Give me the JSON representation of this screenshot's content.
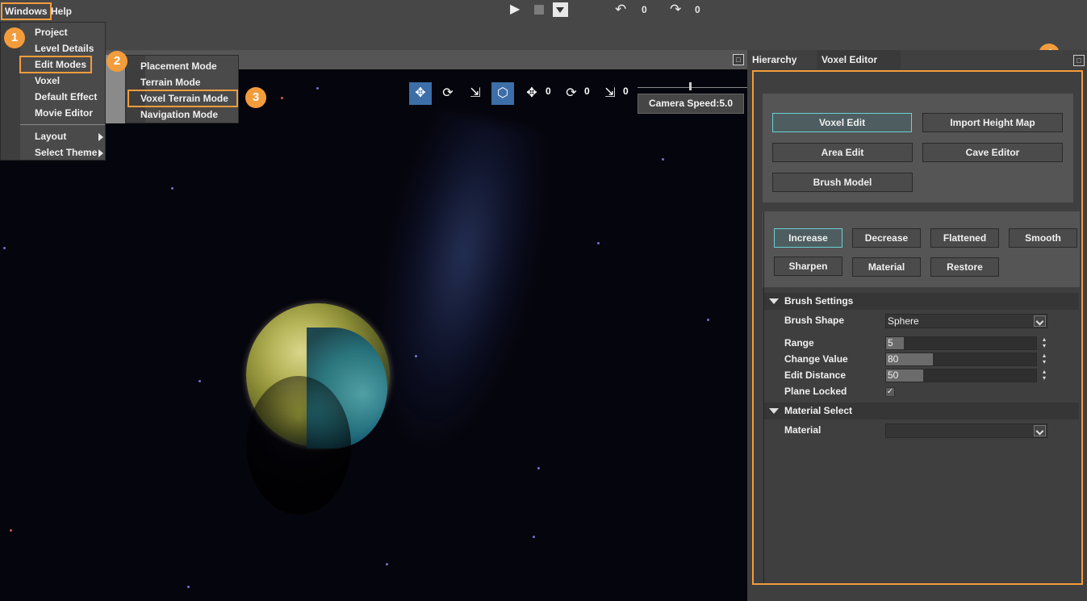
{
  "menubar": {
    "windows": "Windows",
    "help": "Help"
  },
  "toolbar": {
    "play_icon": "play-icon",
    "stop_icon": "stop-icon",
    "dropdown_icon": "dropdown-icon",
    "undo_count": "0",
    "redo_count": "0"
  },
  "windows_menu": {
    "items": [
      "Project",
      "Level Details",
      "Edit Modes",
      "Voxel",
      "Default Effect",
      "Movie Editor"
    ],
    "items2": [
      "Layout",
      "Select Theme"
    ]
  },
  "edit_modes_menu": {
    "items": [
      "Placement Mode",
      "Terrain Mode",
      "Voxel Terrain Mode",
      "Navigation Mode"
    ]
  },
  "badges": [
    "1",
    "2",
    "3",
    "4"
  ],
  "gizmo": {
    "move_count": "0",
    "rotate_count": "0",
    "scale_count": "0",
    "camera_speed": "Camera Speed:5.0",
    "camera_speed_value": 0.5
  },
  "panel": {
    "tabs": [
      "Hierarchy",
      "Voxel Editor"
    ],
    "modes": [
      "Voxel Edit",
      "Import Height Map",
      "Area Edit",
      "Cave Editor",
      "Brush Model"
    ],
    "brush_ops": [
      "Increase",
      "Decrease",
      "Flattened",
      "Smooth",
      "Sharpen",
      "Material",
      "Restore"
    ],
    "brush_settings": {
      "title": "Brush Settings",
      "shape_label": "Brush Shape",
      "shape_value": "Sphere",
      "range_label": "Range",
      "range_value": "5",
      "change_label": "Change Value",
      "change_value": "80",
      "distance_label": "Edit Distance",
      "distance_value": "50",
      "plane_label": "Plane Locked",
      "plane_checked": "✓"
    },
    "material_select": {
      "title": "Material Select",
      "material_label": "Material",
      "material_value": ""
    }
  },
  "colors": {
    "highlight": "#f39c3c",
    "selected_button_border": "#6ad0d6",
    "active_gizmo": "#3d6ea8"
  }
}
